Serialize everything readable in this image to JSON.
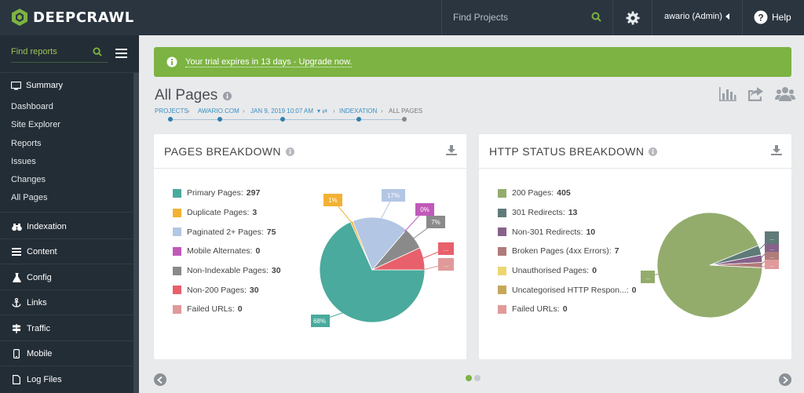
{
  "app": {
    "logo_text": "DEEPCRAWL"
  },
  "topbar": {
    "find_projects_placeholder": "Find Projects",
    "user_label": "awario (Admin)",
    "help_label": "Help"
  },
  "sidebar": {
    "find_reports_placeholder": "Find reports",
    "summary_label": "Summary",
    "sub_items": [
      "Dashboard",
      "Site Explorer",
      "Reports",
      "Issues",
      "Changes",
      "All Pages"
    ],
    "sections": [
      "Indexation",
      "Content",
      "Config",
      "Links",
      "Traffic",
      "Mobile",
      "Log Files"
    ]
  },
  "banner": {
    "text": "Your trial expires in 13 days - Upgrade now."
  },
  "page": {
    "title": "All Pages",
    "breadcrumb": [
      "PROJECTS",
      "AWARIO.COM",
      "JAN 9, 2019 10:07 AM",
      "INDEXATION",
      "ALL PAGES"
    ]
  },
  "colors": {
    "topbar": "#2a3540",
    "sidebar": "#232d36",
    "accent_green": "#7cb342",
    "link_blue": "#3a8fc0"
  },
  "chart_data": [
    {
      "type": "pie",
      "title": "PAGES BREAKDOWN",
      "series": [
        {
          "name": "Primary Pages",
          "value": 297,
          "color": "#4aaa9d",
          "label": "68%"
        },
        {
          "name": "Duplicate Pages",
          "value": 3,
          "color": "#f2b134",
          "label": "1%"
        },
        {
          "name": "Paginated 2+ Pages",
          "value": 75,
          "color": "#b3c6e3",
          "label": "17%"
        },
        {
          "name": "Mobile Alternates",
          "value": 0,
          "color": "#c159b9",
          "label": "0%"
        },
        {
          "name": "Non-Indexable Pages",
          "value": 30,
          "color": "#8a8a8a",
          "label": "7%"
        },
        {
          "name": "Non-200 Pages",
          "value": 30,
          "color": "#e8606b",
          "label": "..."
        },
        {
          "name": "Failed URLs",
          "value": 0,
          "color": "#e09a9a",
          "label": "..."
        }
      ]
    },
    {
      "type": "pie",
      "title": "HTTP STATUS BREAKDOWN",
      "series": [
        {
          "name": "200 Pages",
          "value": 405,
          "color": "#93ac6c",
          "label": "..."
        },
        {
          "name": "301 Redirects",
          "value": 13,
          "color": "#5f7b78",
          "label": "..."
        },
        {
          "name": "Non-301 Redirects",
          "value": 10,
          "color": "#86628a",
          "label": "..."
        },
        {
          "name": "Broken Pages (4xx Errors)",
          "value": 7,
          "color": "#b07b7b",
          "label": "..."
        },
        {
          "name": "Unauthorised Pages",
          "value": 0,
          "color": "#ecd672",
          "label": ""
        },
        {
          "name": "Uncategorised HTTP Respon...",
          "value": 0,
          "color": "#c7a85a",
          "label": ""
        },
        {
          "name": "Failed URLs",
          "value": 0,
          "color": "#e09a9a",
          "label": "..."
        }
      ]
    }
  ]
}
